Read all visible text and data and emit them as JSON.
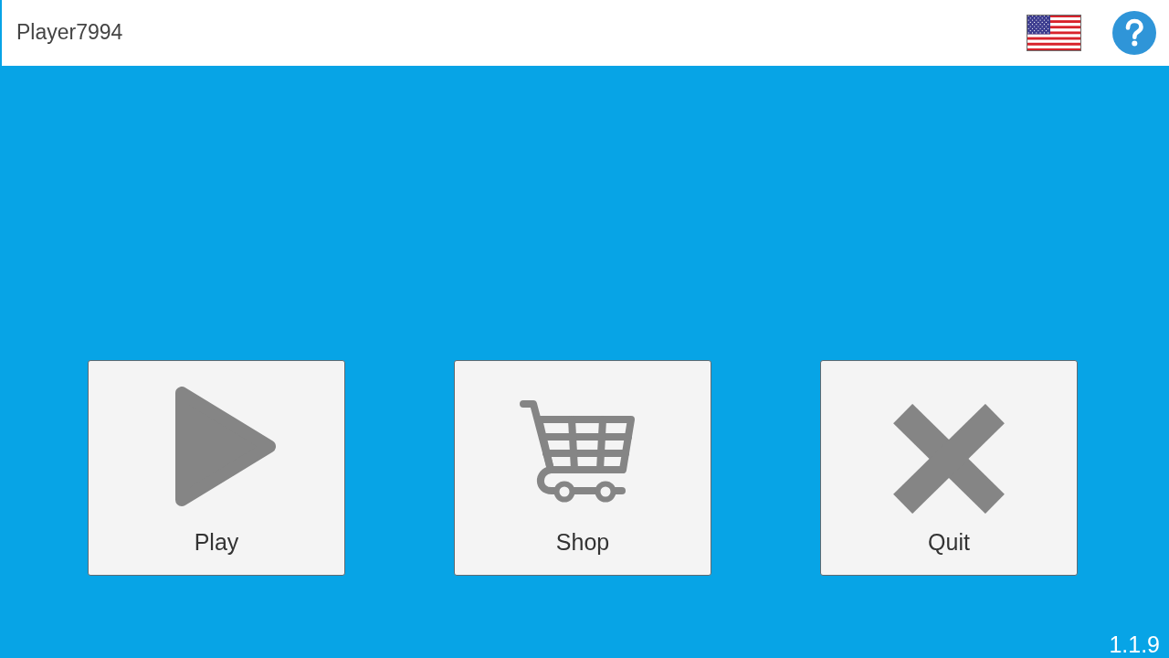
{
  "header": {
    "player_name": "Player7994"
  },
  "menu_buttons": [
    {
      "kind": "play",
      "label": "Play"
    },
    {
      "kind": "shop",
      "label": "Shop"
    },
    {
      "kind": "quit",
      "label": "Quit"
    }
  ],
  "version": "1.1.9"
}
